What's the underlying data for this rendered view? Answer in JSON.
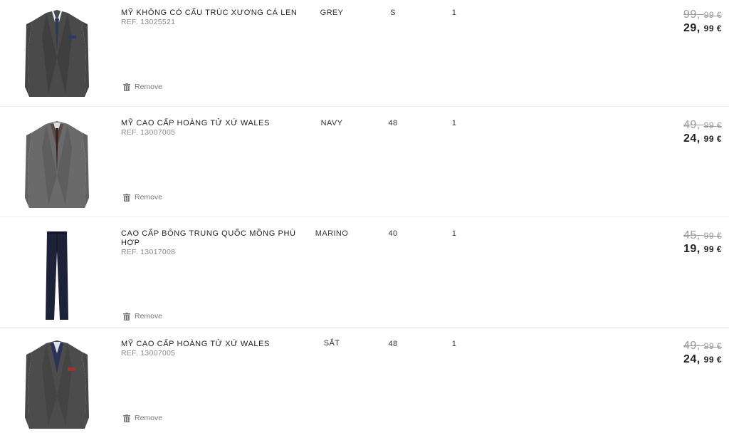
{
  "cart": {
    "items": [
      {
        "name": "MỸ KHÔNG CÓ CẤU TRÚC XƯƠNG CÁ LEN",
        "ref": "REF. 13025521",
        "color": "GREY",
        "size": "S",
        "qty": "1",
        "old_price_int": "99,",
        "old_price_dec": "99 €",
        "new_price_int": "29,",
        "new_price_dec": "99 €",
        "remove_label": "Remove",
        "image_icon": "grey-herringbone-blazer-image"
      },
      {
        "name": "MỸ CAO CẤP HOÀNG TỬ XỨ WALES",
        "ref": "REF. 13007005",
        "color": "NAVY",
        "size": "48",
        "qty": "1",
        "old_price_int": "49,",
        "old_price_dec": "99 €",
        "new_price_int": "24,",
        "new_price_dec": "99 €",
        "remove_label": "Remove",
        "image_icon": "prince-of-wales-blazer-image"
      },
      {
        "name": "CAO CẤP BÔNG TRUNG QUỐC MỒNG PHÙ HỢP",
        "ref": "REF. 13017008",
        "color": "MARINO",
        "size": "40",
        "qty": "1",
        "old_price_int": "45,",
        "old_price_dec": "99 €",
        "new_price_int": "19,",
        "new_price_dec": "99 €",
        "remove_label": "Remove",
        "image_icon": "navy-chino-trousers-image"
      },
      {
        "name": "MỸ CAO CẤP HOÀNG TỬ XỨ WALES",
        "ref": "REF. 13007005",
        "color": "SẮT",
        "size": "48",
        "qty": "1",
        "old_price_int": "49,",
        "old_price_dec": "99 €",
        "new_price_int": "24,",
        "new_price_dec": "99 €",
        "remove_label": "Remove",
        "image_icon": "check-blazer-image"
      }
    ]
  },
  "colors": {
    "text": "#222222",
    "muted": "#888888",
    "divider": "#ececec",
    "strike": "#999999"
  }
}
